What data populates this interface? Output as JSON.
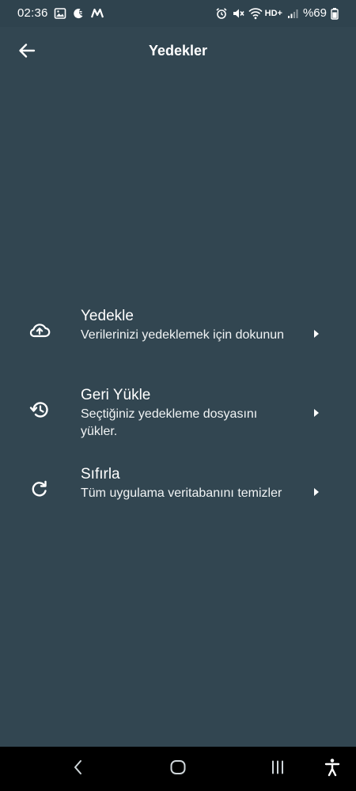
{
  "status_bar": {
    "time": "02:36",
    "battery_percent": "%69",
    "hd_label": "HD+",
    "icons_left": [
      "gallery-icon",
      "moon-icon",
      "m-app-icon"
    ],
    "icons_right": [
      "alarm-icon",
      "mute-icon",
      "wifi-icon",
      "hd-icon",
      "signal-icon",
      "battery-icon"
    ]
  },
  "app_bar": {
    "title": "Yedekler",
    "back_icon": "arrow-left-icon"
  },
  "menu": {
    "items": [
      {
        "title": "Yedekle",
        "subtitle": "Verilerinizi yedeklemek için dokunun",
        "icon": "cloud-upload-icon"
      },
      {
        "title": "Geri Yükle",
        "subtitle": "Seçtiğiniz yedekleme dosyasını yükler.",
        "icon": "restore-history-icon"
      },
      {
        "title": "Sıfırla",
        "subtitle": "Tüm uygulama veritabanını temizler",
        "icon": "refresh-icon"
      }
    ],
    "arrow_icon": "caret-right-icon"
  },
  "nav_bar": {
    "icons": [
      "nav-back-icon",
      "nav-home-icon",
      "nav-recents-icon",
      "accessibility-icon"
    ]
  },
  "colors": {
    "background": "#324651",
    "status_bar": "#2f434e",
    "nav_bar": "#000000",
    "text": "#ffffff"
  }
}
